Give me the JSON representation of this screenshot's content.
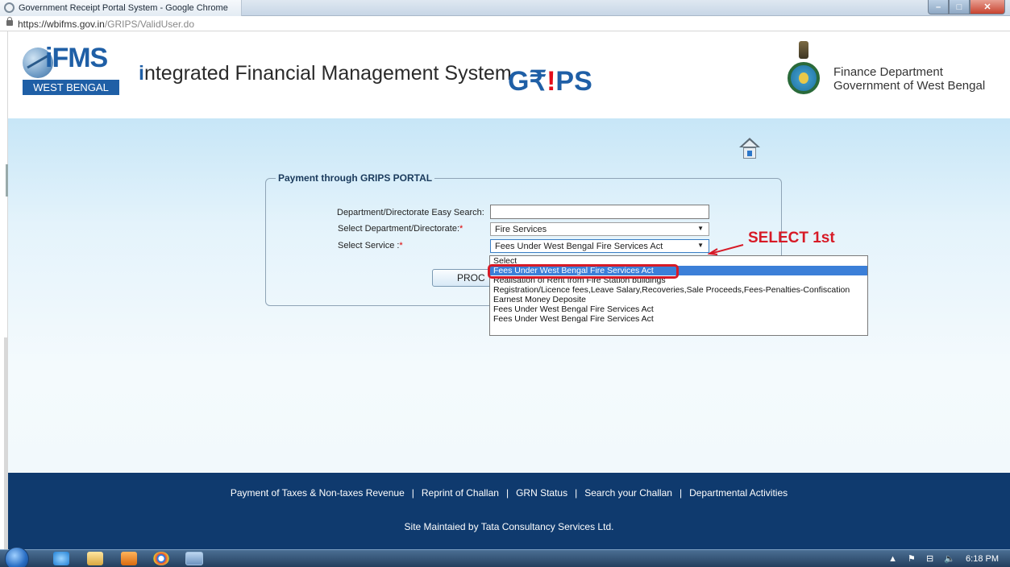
{
  "window": {
    "title": "Government Receipt Portal System - Google Chrome"
  },
  "address_bar": {
    "url_host": "https://wbifms.gov.in",
    "url_path": "/GRIPS/ValidUser.do"
  },
  "header": {
    "ifms_logo_text": "iFMS",
    "ifms_region": "WEST BENGAL",
    "system_name_initial": "i",
    "system_name_rest": "ntegrated Financial Management System",
    "grips_logo_a": "G",
    "grips_logo_b": "₹",
    "grips_logo_c": "!",
    "grips_logo_d": "PS",
    "dept_line1": "Finance Department",
    "dept_line2": "Government of West Bengal"
  },
  "form": {
    "legend": "Payment through GRIPS PORTAL",
    "easy_search_label": "Department/Directorate Easy Search:",
    "easy_search_value": "",
    "department_label": "Select Department/Directorate:",
    "department_value": "Fire Services",
    "service_label": "Select Service :",
    "service_value": "Fees Under West Bengal Fire Services Act",
    "required_mark": "*",
    "proceed_label": "PROC"
  },
  "service_options": [
    "Select",
    "Fees Under West Bengal Fire Services Act",
    "Realisation of Rent from Fire Station buildings",
    "Registration/Licence fees,Leave Salary,Recoveries,Sale Proceeds,Fees-Penalties-Confiscation",
    "Earnest Money Deposite",
    "Fees Under West Bengal Fire Services Act",
    "Fees Under West Bengal Fire Services Act"
  ],
  "selected_option_index": 1,
  "annotation": {
    "text": "SELECT 1st",
    "color": "#d71a26"
  },
  "footer": {
    "links": [
      "Payment of Taxes & Non-taxes Revenue",
      "Reprint of Challan",
      "GRN Status",
      "Search your Challan",
      "Departmental Activities"
    ],
    "separator": "|",
    "credit": "Site Maintaied by Tata Consultancy Services Ltd."
  },
  "taskbar": {
    "clock": "6:18 PM",
    "tray_arrow": "▲",
    "tray_flag": "⚑",
    "tray_network": "⊟",
    "tray_volume": "🔈",
    "apps": [
      "internet-explorer",
      "file-explorer",
      "media-player",
      "chrome",
      "mail"
    ]
  },
  "colors": {
    "brand_blue": "#1f5fa6",
    "footer_bg": "#0f3a6e",
    "highlight": "#3b7fd8",
    "annotation_red": "#d71a26"
  }
}
